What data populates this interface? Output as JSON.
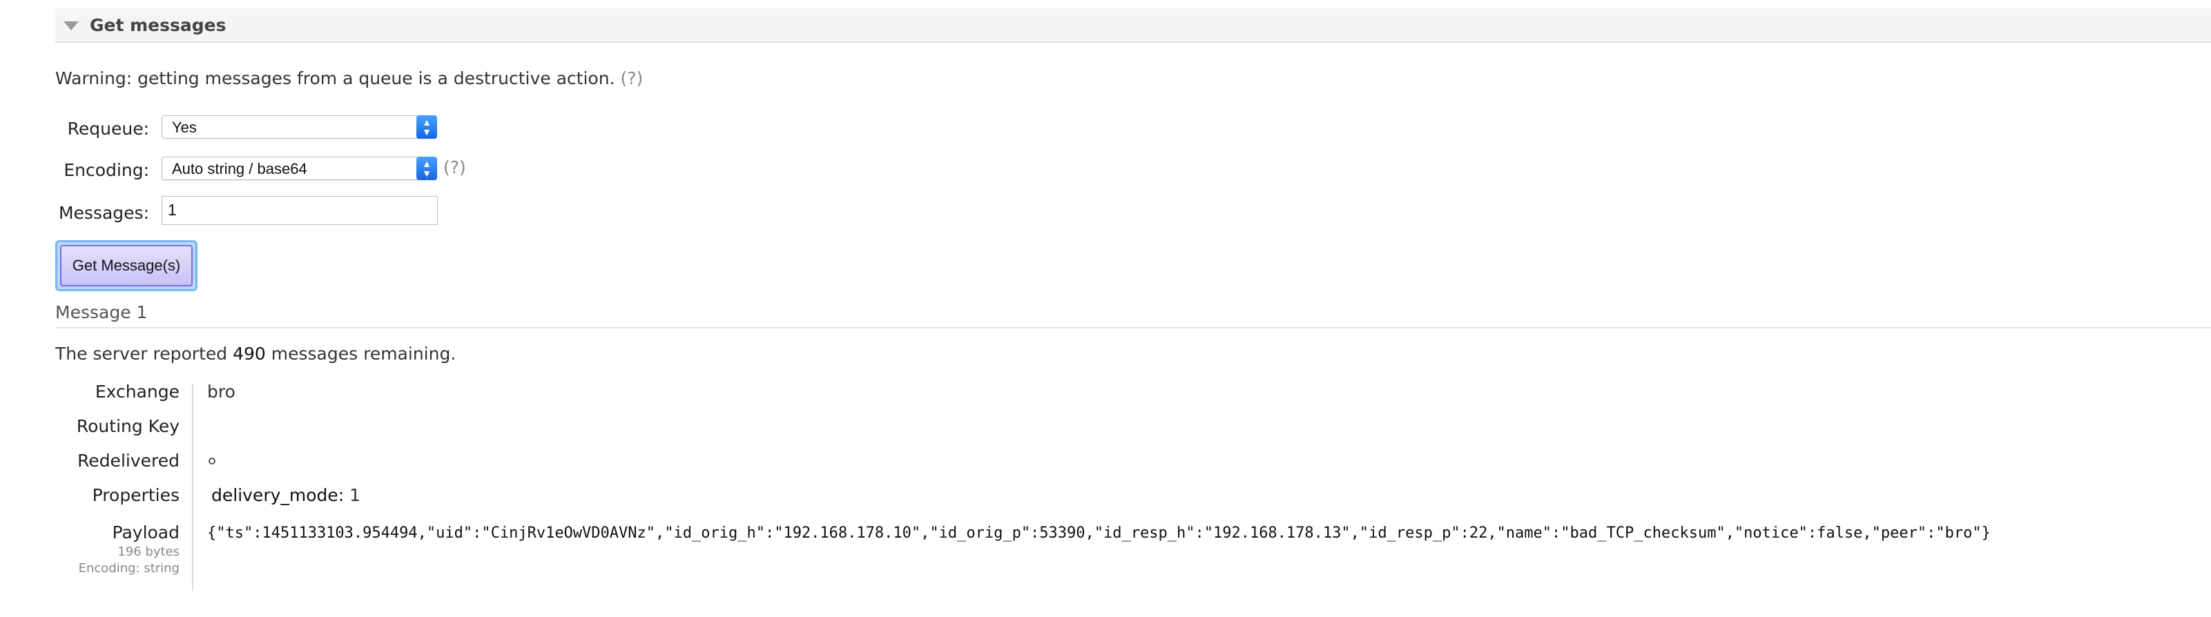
{
  "section": {
    "title": "Get messages"
  },
  "warning": {
    "text": "Warning: getting messages from a queue is a destructive action.",
    "help": "(?)"
  },
  "form": {
    "requeue_label": "Requeue:",
    "requeue_value": "Yes",
    "encoding_label": "Encoding:",
    "encoding_value": "Auto string / base64",
    "encoding_help": "(?)",
    "messages_label": "Messages:",
    "messages_value": "1",
    "submit_label": "Get Message(s)"
  },
  "message": {
    "title": "Message 1",
    "remaining_prefix": "The server reported ",
    "remaining_count": "490",
    "remaining_suffix": " messages remaining.",
    "exchange_label": "Exchange",
    "exchange_value": "bro",
    "routing_key_label": "Routing Key",
    "routing_key_value": "",
    "redelivered_label": "Redelivered",
    "properties_label": "Properties",
    "properties_key": "delivery_mode:",
    "properties_value": "1",
    "payload_label": "Payload",
    "payload_size": "196 bytes",
    "payload_encoding": "Encoding: string",
    "payload_value": "{\"ts\":1451133103.954494,\"uid\":\"CinjRv1eOwVD0AVNz\",\"id_orig_h\":\"192.168.178.10\",\"id_orig_p\":53390,\"id_resp_h\":\"192.168.178.13\",\"id_resp_p\":22,\"name\":\"bad_TCP_checksum\",\"notice\":false,\"peer\":\"bro\"}"
  },
  "colors": {
    "accent_blue": "#1666e0",
    "button_purple": "#c7c2f5"
  },
  "icons": {
    "section_toggle": "triangle-down-icon",
    "select_arrows": "updown-chevron-icon",
    "redelivered": "empty-circle-icon"
  }
}
